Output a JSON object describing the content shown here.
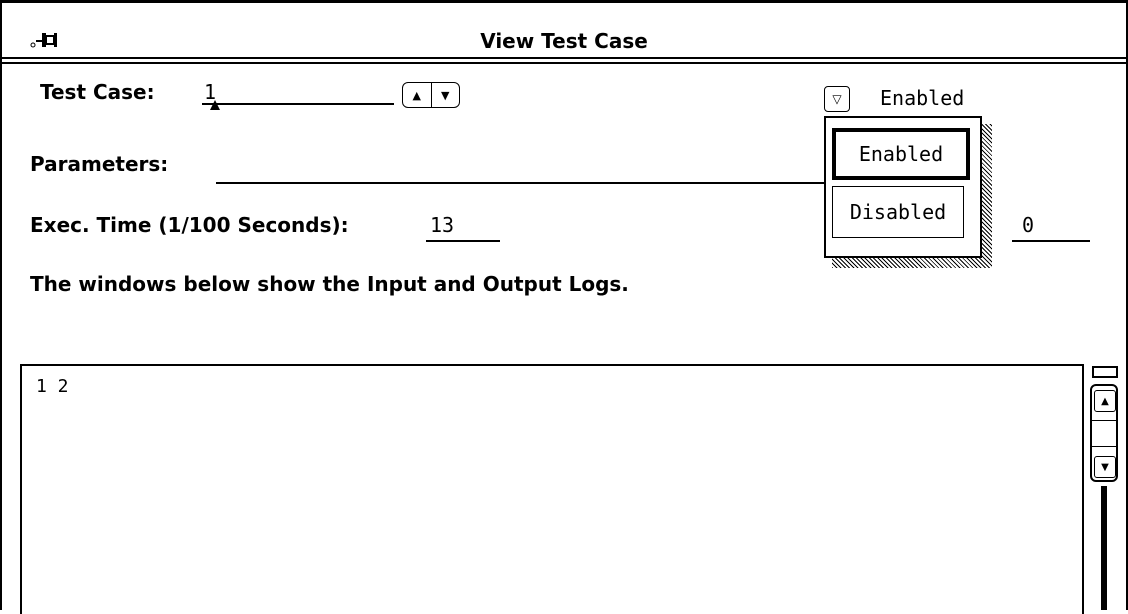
{
  "window": {
    "title": "View Test Case"
  },
  "test_case": {
    "label": "Test Case:",
    "value": "1"
  },
  "enable_menu": {
    "current_value": "Enabled",
    "options": [
      "Enabled",
      "Disabled"
    ],
    "selected": "Enabled"
  },
  "parameters": {
    "label": "Parameters:",
    "value": ""
  },
  "exec_time": {
    "label": "Exec. Time (1/100 Seconds):",
    "value": "13"
  },
  "right_field": {
    "value": "0"
  },
  "info_text": "The windows below show the Input and Output Logs.",
  "input_log": {
    "content": "1 2"
  }
}
